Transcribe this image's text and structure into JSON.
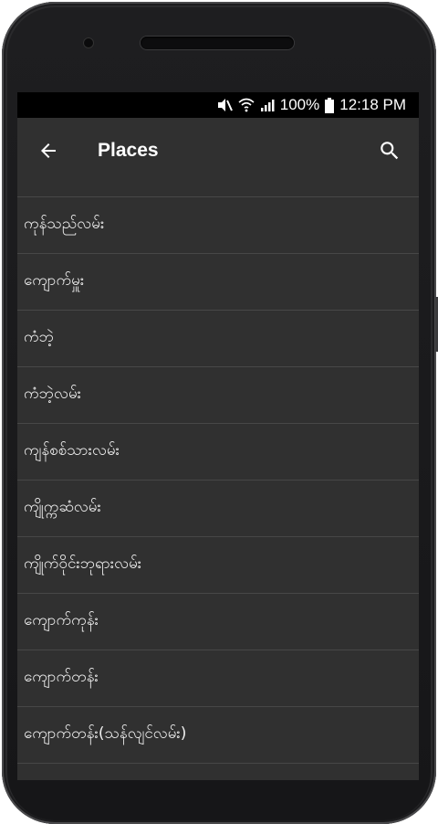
{
  "status_bar": {
    "battery": "100%",
    "time": "12:18 PM",
    "icons": [
      "mute-icon",
      "wifi-icon",
      "signal-icon",
      "battery-icon"
    ]
  },
  "toolbar": {
    "title": "Places",
    "back_icon": "arrow-back-icon",
    "search_icon": "search-icon"
  },
  "places": [
    "ကုန်သည်လမ်း",
    "ကျောက်မှူး",
    "ကံဘဲ့",
    "ကံဘဲ့လမ်း",
    "ကျန်စစ်သားလမ်း",
    "ကျိုက္ကဆံလမ်း",
    "ကျိုက်ဝိုင်းဘုရားလမ်း",
    "ကျောက်ကုန်း",
    "ကျောက်တန်း",
    "ကျောက်တန်း(သန်လျင်လမ်း)"
  ],
  "colors": {
    "screen_bg": "#303030",
    "status_bg": "#000000",
    "divider": "#474747",
    "text": "#f0f0f0"
  }
}
